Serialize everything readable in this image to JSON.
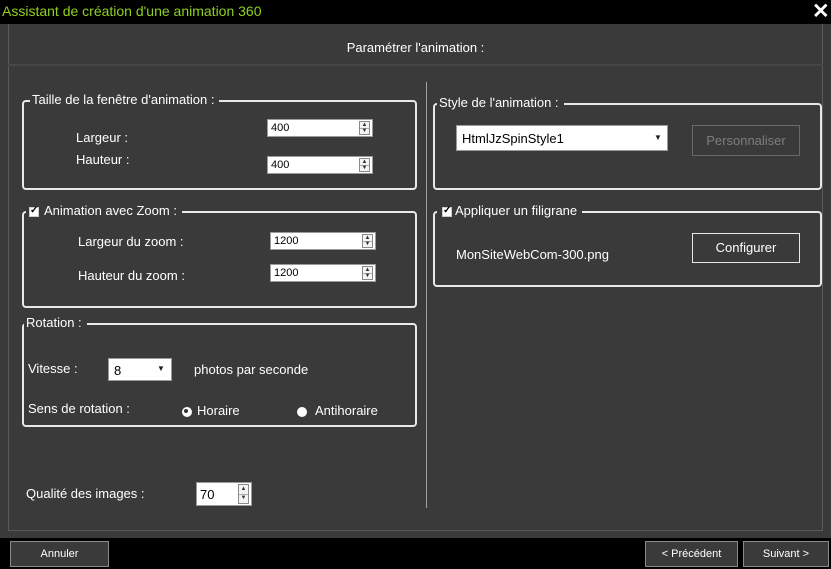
{
  "window": {
    "title": "Assistant de création d'une animation 360",
    "close": "✕"
  },
  "header": {
    "subtitle": "Paramétrer l'animation :"
  },
  "window_size": {
    "legend": "Taille de la fenêtre d'animation :",
    "width_label": "Largeur :",
    "width_value": "400",
    "height_label": "Hauteur :",
    "height_value": "400"
  },
  "zoom": {
    "checked": true,
    "legend": "Animation avec Zoom :",
    "width_label": "Largeur du zoom :",
    "width_value": "1200",
    "height_label": "Hauteur du zoom :",
    "height_value": "1200"
  },
  "rotation": {
    "legend": "Rotation :",
    "speed_label": "Vitesse :",
    "speed_value": "8",
    "speed_unit": "photos par seconde",
    "direction_label": "Sens de rotation :",
    "clockwise_label": "Horaire",
    "clockwise_selected": true,
    "counter_label": "Antihoraire",
    "counter_selected": false
  },
  "quality": {
    "label": "Qualité des images :",
    "value": "70"
  },
  "style": {
    "legend": "Style de l'animation :",
    "selected": "HtmlJzSpinStyle1",
    "customize_label": "Personnaliser"
  },
  "watermark": {
    "checked": true,
    "legend": "Appliquer un filigrane",
    "file": "MonSiteWebCom-300.png",
    "configure_label": "Configurer"
  },
  "footer": {
    "cancel": "Annuler",
    "previous": "< Précédent",
    "next": "Suivant >"
  }
}
